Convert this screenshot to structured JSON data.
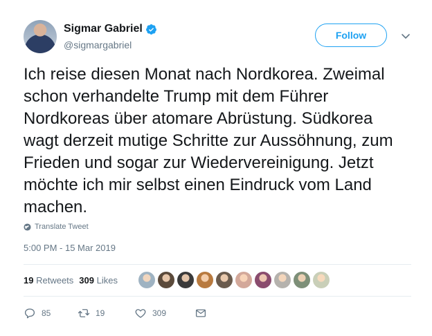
{
  "author": {
    "name": "Sigmar Gabriel",
    "handle": "@sigmargabriel"
  },
  "follow_label": "Follow",
  "tweet": {
    "text": "Ich reise diesen Monat nach Nordkorea. Zweimal schon verhandelte Trump mit dem Führer Nordkoreas über atomare Abrüstung. Südkorea wagt derzeit mutige Schritte zur Aussöhnung, zum Frieden und sogar zur Wiedervereinigung. Jetzt möchte ich mir selbst einen Eindruck vom Land machen.",
    "translate_label": "Translate Tweet",
    "timestamp": "5:00 PM - 15 Mar 2019"
  },
  "stats": {
    "retweets_count": "19",
    "retweets_label": "Retweets",
    "likes_count": "309",
    "likes_label": "Likes"
  },
  "liker_colors": [
    "#9fb3c2",
    "#5b4a3b",
    "#3a3a3a",
    "#b87a3f",
    "#6a5b4d",
    "#d3a89a",
    "#8a4c6e",
    "#b5b2ad",
    "#7d8f78",
    "#c9cfb8"
  ],
  "actions": {
    "reply_count": "85",
    "retweet_count": "19",
    "like_count": "309"
  },
  "colors": {
    "accent": "#1da1f2",
    "text": "#14171a",
    "muted": "#657786"
  }
}
